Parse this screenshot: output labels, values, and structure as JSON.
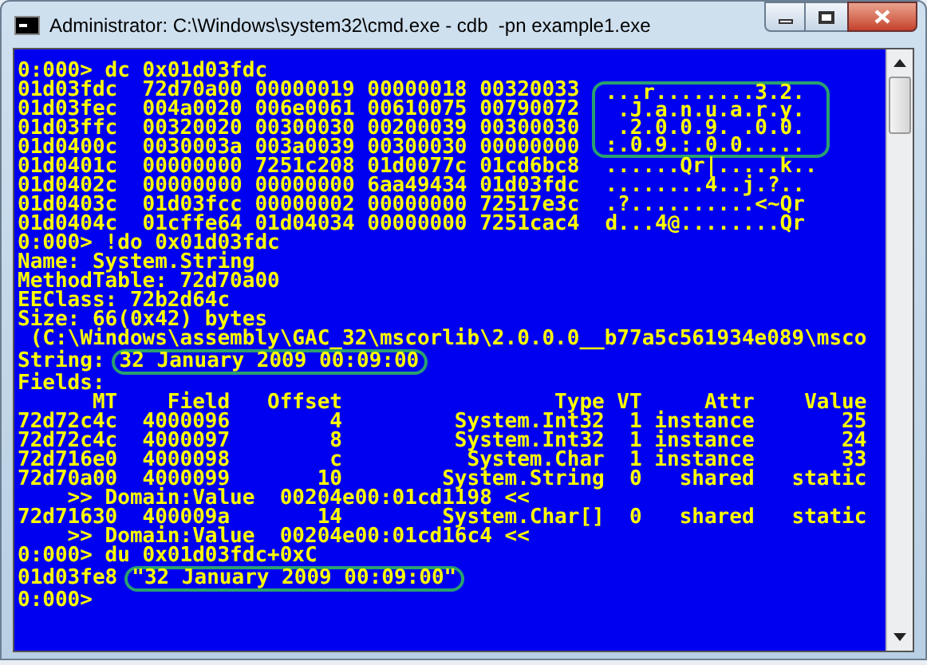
{
  "window": {
    "title": "Administrator: C:\\Windows\\system32\\cmd.exe - cdb  -pn example1.exe"
  },
  "console": {
    "lines": [
      {
        "kind": "text",
        "text": "0:000> dc 0x01d03fdc"
      },
      {
        "kind": "dump",
        "hex": "01d03fdc  72d70a00 00000019 00000018 00320033",
        "ascii": "...r........3.2.",
        "circled": true
      },
      {
        "kind": "dump",
        "hex": "01d03fec  004a0020 006e0061 00610075 00790072",
        "ascii": " .J.a.n.u.a.r.y.",
        "circled": true
      },
      {
        "kind": "dump",
        "hex": "01d03ffc  00320020 00300030 00200039 00300030",
        "ascii": " .2.0.0.9. .0.0.",
        "circled": true
      },
      {
        "kind": "dump",
        "hex": "01d0400c  0030003a 003a0039 00300030 00000000",
        "ascii": ":.0.9.:.0.0.....",
        "circled": true
      },
      {
        "kind": "dump",
        "hex": "01d0401c  00000000 7251c208 01d0077c 01cd6bc8",
        "ascii": "......Qr|.....k..",
        "circled": false
      },
      {
        "kind": "dump",
        "hex": "01d0402c  00000000 00000000 6aa49434 01d03fdc",
        "ascii": "........4..j.?..",
        "circled": false
      },
      {
        "kind": "dump",
        "hex": "01d0403c  01d03fcc 00000002 00000000 72517e3c",
        "ascii": ".?..........<~Qr",
        "circled": false
      },
      {
        "kind": "dump",
        "hex": "01d0404c  01cffe64 01d04034 00000000 7251cac4",
        "ascii": "d...4@........Qr",
        "circled": false
      },
      {
        "kind": "text",
        "text": "0:000> !do 0x01d03fdc"
      },
      {
        "kind": "text",
        "text": "Name: System.String"
      },
      {
        "kind": "text",
        "text": "MethodTable: 72d70a00"
      },
      {
        "kind": "text",
        "text": "EEClass: 72b2d64c"
      },
      {
        "kind": "text",
        "text": "Size: 66(0x42) bytes"
      },
      {
        "kind": "text",
        "text": " (C:\\Windows\\assembly\\GAC_32\\mscorlib\\2.0.0.0__b77a5c561934e089\\msco"
      },
      {
        "kind": "marked",
        "text": "String:",
        "mark": "32 January 2009 00:09:00"
      },
      {
        "kind": "text",
        "text": "Fields:"
      },
      {
        "kind": "text",
        "text": "      MT    Field   Offset                 Type VT     Attr    Value"
      },
      {
        "kind": "text",
        "text": "72d72c4c  4000096        4         System.Int32  1 instance       25"
      },
      {
        "kind": "text",
        "text": "72d72c4c  4000097        8         System.Int32  1 instance       24"
      },
      {
        "kind": "text",
        "text": "72d716e0  4000098        c          System.Char  1 instance       33"
      },
      {
        "kind": "text",
        "text": "72d70a00  4000099       10        System.String  0   shared   static"
      },
      {
        "kind": "text",
        "text": "    >> Domain:Value  00204e00:01cd1198 <<"
      },
      {
        "kind": "text",
        "text": "72d71630  400009a       14        System.Char[]  0   shared   static"
      },
      {
        "kind": "text",
        "text": "    >> Domain:Value  00204e00:01cd16c4 <<"
      },
      {
        "kind": "text",
        "text": "0:000> du 0x01d03fdc+0xC"
      },
      {
        "kind": "marked",
        "text": "01d03fe8",
        "mark": "\"32 January 2009 00:09:00\""
      },
      {
        "kind": "text",
        "text": "0:000>"
      }
    ]
  }
}
